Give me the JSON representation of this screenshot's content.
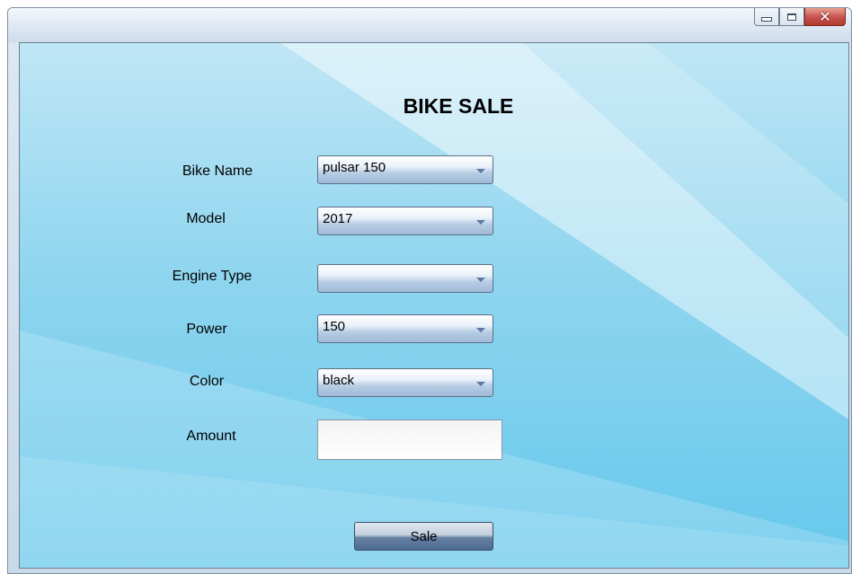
{
  "window": {
    "caption_buttons": {
      "minimize_icon": "minimize-icon",
      "maximize_icon": "maximize-icon",
      "close_icon": "close-icon",
      "close_glyph": "✕"
    }
  },
  "form": {
    "title": "BIKE SALE",
    "fields": {
      "bike_name": {
        "label": "Bike Name",
        "value": "pulsar 150"
      },
      "model": {
        "label": "Model",
        "value": "2017"
      },
      "engine_type": {
        "label": "Engine Type",
        "value": ""
      },
      "power": {
        "label": "Power",
        "value": "150"
      },
      "color": {
        "label": "Color",
        "value": "black"
      },
      "amount": {
        "label": "Amount",
        "value": ""
      }
    },
    "sale_button": "Sale"
  },
  "colors": {
    "background_light": "#bfe6f5",
    "background_dark": "#66c8ec",
    "close_button": "#c75050"
  }
}
